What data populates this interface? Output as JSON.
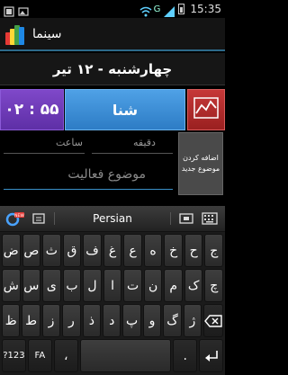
{
  "status_bar": {
    "time": "15:35",
    "network": "G",
    "icons": [
      "notification-icon",
      "image-icon",
      "wifi-icon",
      "signal-icon",
      "battery-icon"
    ]
  },
  "title_bar": {
    "title": "سینما",
    "logo_colors": [
      "#e53935",
      "#fdd835",
      "#43a047",
      "#1e88e5"
    ]
  },
  "date": "چهارشنبه - ۱۲ تیر",
  "shift": {
    "time": "۰۲ : ۵۵",
    "label": "شنا",
    "chart_icon": "line-chart-icon"
  },
  "form": {
    "minute_label": "دقیقه",
    "hour_label": "ساعت",
    "activity_placeholder": "موضوع فعالیت",
    "add_button": "اضافه کردن موضوع جدید"
  },
  "keyboard": {
    "language": "Persian",
    "new_badge": "NEW",
    "row1": [
      "ض",
      "ص",
      "ث",
      "ق",
      "ف",
      "غ",
      "ع",
      "ه",
      "خ",
      "ح",
      "ج"
    ],
    "row2": [
      "ش",
      "س",
      "ی",
      "ب",
      "ل",
      "ا",
      "ت",
      "ن",
      "م",
      "ک",
      "چ"
    ],
    "row3": [
      "ظ",
      "ط",
      "ز",
      "ر",
      "ذ",
      "د",
      "پ",
      "و",
      "گ",
      "ژ"
    ],
    "bottom": {
      "symbols": "?123",
      "fa": "FA",
      "comma": "،",
      "period": ".",
      "space": ""
    }
  }
}
